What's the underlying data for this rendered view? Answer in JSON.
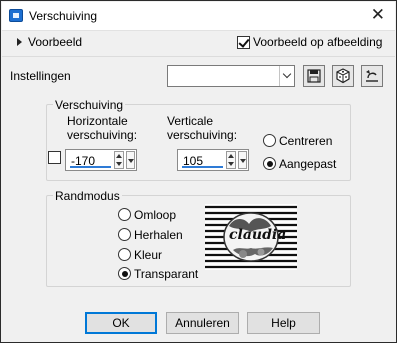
{
  "window": {
    "title": "Verschuiving",
    "close_glyph": "✕",
    "app_icon": "app-icon"
  },
  "preview": {
    "expander_label": "Voorbeeld",
    "preview_on_image_label": "Voorbeeld op afbeelding",
    "preview_on_image_checked": true
  },
  "presets": {
    "label": "Instellingen",
    "value": "",
    "tools": [
      "save-preset-icon",
      "randomize-dice-icon",
      "reset-default-icon"
    ]
  },
  "offset": {
    "group_label": "Verschuiving",
    "horizontal_label_line1": "Horizontale",
    "horizontal_label_line2": "verschuiving:",
    "horizontal_value": "-170",
    "vertical_label_line1": "Verticale",
    "vertical_label_line2": "verschuiving:",
    "vertical_value": "105",
    "link_checked": false,
    "center_label": "Centreren",
    "custom_label": "Aangepast",
    "selected": "custom"
  },
  "edge_mode": {
    "group_label": "Randmodus",
    "options": [
      "Omloop",
      "Herhalen",
      "Kleur",
      "Transparant"
    ],
    "selected": "Transparant",
    "preview_watermark": "claudia"
  },
  "buttons": {
    "ok": "OK",
    "cancel": "Annuleren",
    "help": "Help"
  },
  "colors": {
    "accent": "#0078d7",
    "field_underline": "#2e7bd6",
    "dialog_bg": "#f0f0f0"
  }
}
